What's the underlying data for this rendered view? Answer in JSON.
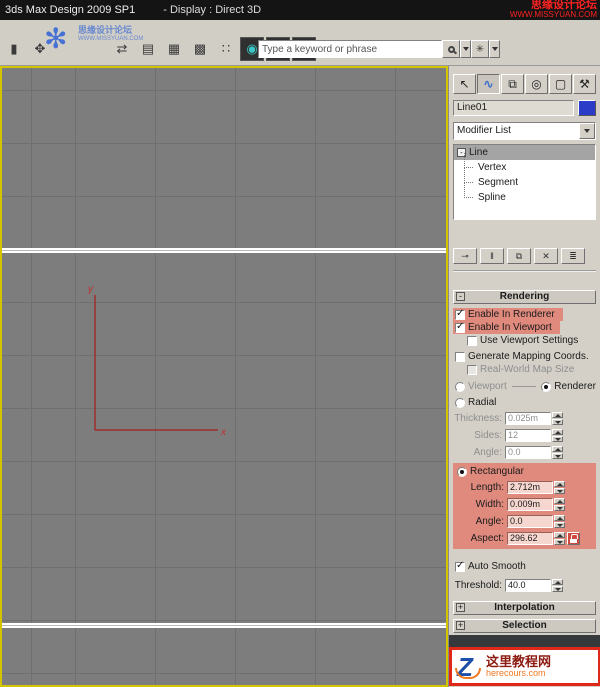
{
  "colors": {
    "accent_yellow": "#d4c400",
    "highlight_red": "#e08a7e",
    "viewport_gray": "#7d7d7d",
    "grid_line": "#6f6f6f",
    "spline_red": "#9e2f2f",
    "panel_gray": "#d4d0c8",
    "object_color_swatch": "#2a3cc8",
    "watermark_red": "#ff2222",
    "watermark_blue": "#2f62d6",
    "logo_blue": "#1d4ea8",
    "logo_orange": "#f07820",
    "logo_border_red": "#e02818"
  },
  "title_bar": {
    "title": "3ds Max Design 2009 SP1",
    "display_mode": "- Display : Direct 3D"
  },
  "watermark_top": {
    "line1": "思缘设计论坛",
    "line2": "WWW.MISSYUAN.COM"
  },
  "watermark_toolbar": {
    "flower_glyph": "✻",
    "line1": "思缘设计论坛",
    "line2": "WWW.MISSYUAN.COM"
  },
  "toolbar": {
    "search_value": "Type a keyword or phrase",
    "star_glyph": "✳",
    "icons": [
      {
        "name": "cropped-left-icon",
        "glyph": "▮"
      },
      {
        "name": "toolbar-icon-2",
        "glyph": "✥"
      },
      {
        "name": "mirror-icon",
        "glyph": "⇄"
      },
      {
        "name": "layer-manager-icon",
        "glyph": "▤"
      },
      {
        "name": "graphite-tools-icon",
        "glyph": "▦"
      },
      {
        "name": "curve-editor-icon",
        "glyph": "▩"
      },
      {
        "name": "color-swatches-icon",
        "glyph": "∷"
      },
      {
        "name": "material-editor-icon",
        "glyph": "◉"
      },
      {
        "name": "render-setup-icon",
        "glyph": "◍"
      },
      {
        "name": "render-production-icon",
        "glyph": "♨"
      }
    ]
  },
  "viewport": {
    "axis_x": "x",
    "axis_y": "y"
  },
  "command_panel": {
    "tabs": [
      {
        "name": "create",
        "glyph": "↖"
      },
      {
        "name": "modify",
        "glyph": "∿"
      },
      {
        "name": "hierarchy",
        "glyph": "⧉"
      },
      {
        "name": "motion",
        "glyph": "◎"
      },
      {
        "name": "display",
        "glyph": "▢"
      },
      {
        "name": "utilities",
        "glyph": "⚒"
      }
    ],
    "object_name": "Line01",
    "modifier_list_label": "Modifier List",
    "stack": {
      "expand_glyph": "-",
      "root": "Line",
      "children": [
        "Vertex",
        "Segment",
        "Spline"
      ]
    },
    "stack_buttons": [
      {
        "name": "pin-stack-button",
        "glyph": "⊸"
      },
      {
        "name": "show-end-result-button",
        "glyph": "‖"
      },
      {
        "name": "make-unique-button",
        "glyph": "⧉"
      },
      {
        "name": "remove-modifier-button",
        "glyph": "✕"
      },
      {
        "name": "configure-modifier-sets-button",
        "glyph": "≣"
      }
    ],
    "rendering": {
      "collapse": "-",
      "header": "Rendering",
      "enable_in_renderer": "Enable In Renderer",
      "enable_in_viewport": "Enable In Viewport",
      "use_viewport_settings": "Use Viewport Settings",
      "generate_mapping": "Generate Mapping Coords.",
      "real_world_map": "Real-World Map Size",
      "viewport_label": "Viewport",
      "renderer_label": "Renderer",
      "radial_label": "Radial",
      "thickness_label": "Thickness:",
      "thickness_value": "0.025m",
      "sides_label": "Sides:",
      "sides_value": "12",
      "angle_label": "Angle:",
      "angle_value": "0.0",
      "rectangular_label": "Rectangular",
      "length_label": "Length:",
      "length_value": "2.712m",
      "width_label": "Width:",
      "width_value": "0.009m",
      "angle2_label": "Angle:",
      "angle2_value": "0.0",
      "aspect_label": "Aspect:",
      "aspect_value": "296.62",
      "auto_smooth": "Auto Smooth",
      "threshold_label": "Threshold:",
      "threshold_value": "40.0"
    },
    "rollouts": {
      "interpolation_collapse": "+",
      "interpolation": "Interpolation",
      "selection_collapse": "+",
      "selection": "Selection"
    }
  },
  "logo_badge": {
    "letter": "Z",
    "line1": "这里教程网",
    "line2": "herecours.com"
  }
}
